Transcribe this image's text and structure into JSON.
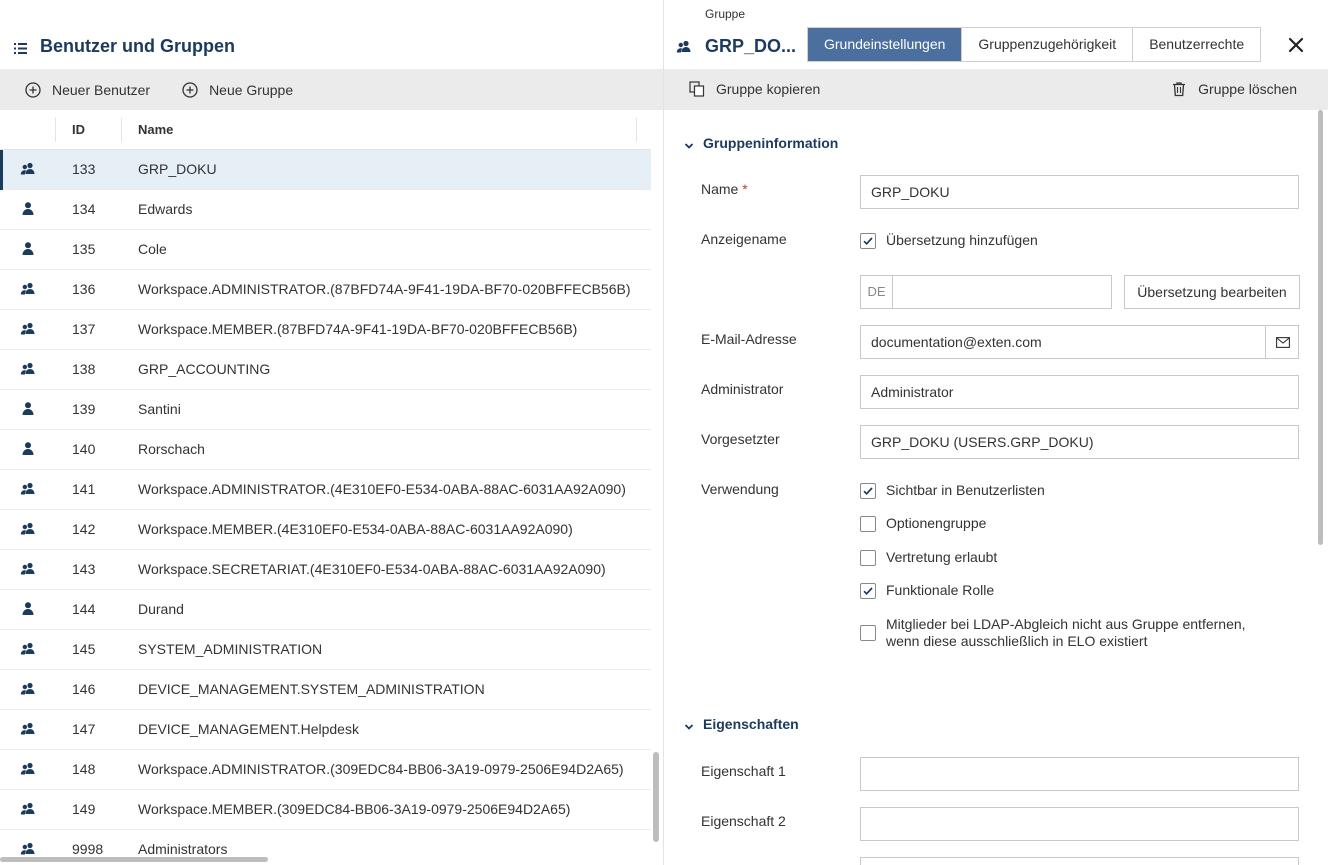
{
  "left": {
    "title": "Benutzer und Gruppen",
    "toolbar": {
      "new_user": "Neuer Benutzer",
      "new_group": "Neue Gruppe"
    },
    "columns": {
      "id": "ID",
      "name": "Name"
    },
    "rows": [
      {
        "type": "group",
        "id": "133",
        "name": "GRP_DOKU",
        "selected": true
      },
      {
        "type": "user",
        "id": "134",
        "name": "Edwards"
      },
      {
        "type": "user",
        "id": "135",
        "name": "Cole"
      },
      {
        "type": "group",
        "id": "136",
        "name": "Workspace.ADMINISTRATOR.(87BFD74A-9F41-19DA-BF70-020BFFECB56B)"
      },
      {
        "type": "group",
        "id": "137",
        "name": "Workspace.MEMBER.(87BFD74A-9F41-19DA-BF70-020BFFECB56B)"
      },
      {
        "type": "group",
        "id": "138",
        "name": "GRP_ACCOUNTING"
      },
      {
        "type": "user",
        "id": "139",
        "name": "Santini"
      },
      {
        "type": "user",
        "id": "140",
        "name": "Rorschach"
      },
      {
        "type": "group",
        "id": "141",
        "name": "Workspace.ADMINISTRATOR.(4E310EF0-E534-0ABA-88AC-6031AA92A090)"
      },
      {
        "type": "group",
        "id": "142",
        "name": "Workspace.MEMBER.(4E310EF0-E534-0ABA-88AC-6031AA92A090)"
      },
      {
        "type": "group",
        "id": "143",
        "name": "Workspace.SECRETARIAT.(4E310EF0-E534-0ABA-88AC-6031AA92A090)"
      },
      {
        "type": "user",
        "id": "144",
        "name": "Durand"
      },
      {
        "type": "group",
        "id": "145",
        "name": "SYSTEM_ADMINISTRATION"
      },
      {
        "type": "group",
        "id": "146",
        "name": "DEVICE_MANAGEMENT.SYSTEM_ADMINISTRATION"
      },
      {
        "type": "group",
        "id": "147",
        "name": "DEVICE_MANAGEMENT.Helpdesk"
      },
      {
        "type": "group",
        "id": "148",
        "name": "Workspace.ADMINISTRATOR.(309EDC84-BB06-3A19-0979-2506E94D2A65)"
      },
      {
        "type": "group",
        "id": "149",
        "name": "Workspace.MEMBER.(309EDC84-BB06-3A19-0979-2506E94D2A65)"
      },
      {
        "type": "group",
        "id": "9998",
        "name": "Administrators"
      }
    ]
  },
  "right": {
    "caption": "Gruppe",
    "title": "GRP_DO...",
    "tabs": [
      {
        "label": "Grundeinstellungen",
        "active": true
      },
      {
        "label": "Gruppenzugehörigkeit",
        "active": false
      },
      {
        "label": "Benutzerrechte",
        "active": false
      }
    ],
    "toolbar": {
      "copy": "Gruppe kopieren",
      "delete": "Gruppe löschen"
    },
    "section_info": "Gruppeninformation",
    "fields": {
      "name_label": "Name",
      "name_required": "*",
      "name_value": "GRP_DOKU",
      "display_label": "Anzeigename",
      "add_translation": "Übersetzung hinzufügen",
      "lang_prefix": "DE",
      "lang_value": "",
      "edit_translation": "Übersetzung bearbeiten",
      "email_label": "E-Mail-Adresse",
      "email_value": "documentation@exten.com",
      "admin_label": "Administrator",
      "admin_value": "Administrator",
      "supervisor_label": "Vorgesetzter",
      "supervisor_value": "GRP_DOKU (USERS.GRP_DOKU)",
      "usage_label": "Verwendung"
    },
    "usage_options": [
      {
        "label": "Sichtbar in Benutzerlisten",
        "checked": true
      },
      {
        "label": "Optionengruppe",
        "checked": false
      },
      {
        "label": "Vertretung erlaubt",
        "checked": false
      },
      {
        "label": "Funktionale Rolle",
        "checked": true
      },
      {
        "label": "Mitglieder bei LDAP-Abgleich nicht aus Gruppe entfernen, wenn diese ausschließlich in ELO existiert",
        "checked": false
      }
    ],
    "section_props": "Eigenschaften",
    "props": [
      {
        "label": "Eigenschaft 1",
        "value": ""
      },
      {
        "label": "Eigenschaft 2",
        "value": ""
      }
    ]
  },
  "colors": {
    "accent": "#1b3a5e",
    "tab_active": "#4b6f9e",
    "selected_row": "#e6eef6",
    "toolbar": "#ebebeb"
  }
}
